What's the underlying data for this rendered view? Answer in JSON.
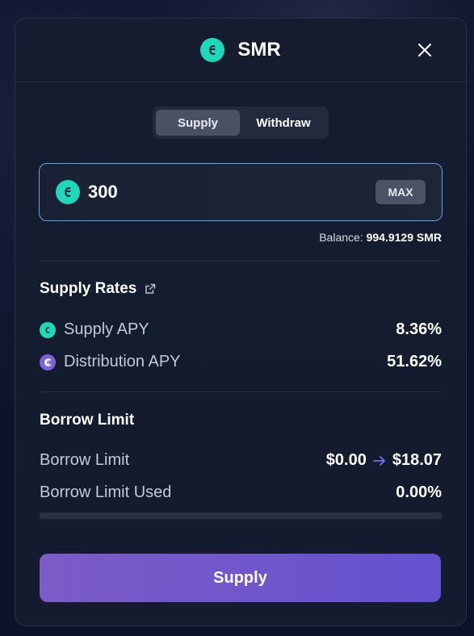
{
  "header": {
    "title": "SMR",
    "close_icon": "close-icon",
    "token_icon": "smr-token-icon"
  },
  "tabs": [
    {
      "label": "Supply",
      "active": true
    },
    {
      "label": "Withdraw",
      "active": false
    }
  ],
  "amount": {
    "value": "300",
    "max_label": "MAX"
  },
  "balance": {
    "label": "Balance:",
    "value": "994.9129 SMR"
  },
  "supply_rates": {
    "title": "Supply Rates",
    "link_icon": "external-link-icon",
    "rows": [
      {
        "label": "Supply APY",
        "value": "8.36%",
        "icon": "smr-token-icon"
      },
      {
        "label": "Distribution APY",
        "value": "51.62%",
        "icon": "distribution-token-icon"
      }
    ]
  },
  "borrow_limit": {
    "title": "Borrow Limit",
    "limit_label": "Borrow Limit",
    "limit_from": "$0.00",
    "limit_to": "$18.07",
    "used_label": "Borrow Limit Used",
    "used_value": "0.00%",
    "used_fraction": 0.0
  },
  "action": {
    "label": "Supply"
  },
  "colors": {
    "accent_teal": "#1fd8b9",
    "accent_purple": "#6c5ce7",
    "input_border": "#5fa8e6",
    "arrow": "#7b6cf5"
  }
}
